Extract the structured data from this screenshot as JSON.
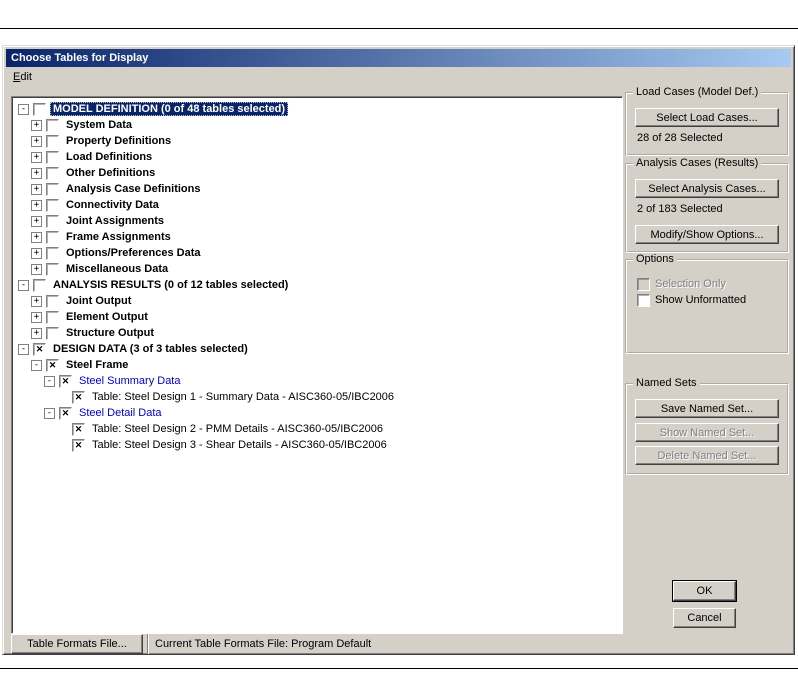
{
  "window": {
    "title": "Choose Tables for Display"
  },
  "menu": {
    "edit": "Edit"
  },
  "tree": {
    "items": [
      {
        "label": "MODEL DEFINITION  (0 of 48 tables selected)",
        "level": 0,
        "exp": "minus",
        "checked": false,
        "bold": true,
        "blue": false,
        "selected": true
      },
      {
        "label": "System Data",
        "level": 1,
        "exp": "plus",
        "checked": false,
        "bold": true,
        "blue": false,
        "selected": false
      },
      {
        "label": "Property Definitions",
        "level": 1,
        "exp": "plus",
        "checked": false,
        "bold": true,
        "blue": false,
        "selected": false
      },
      {
        "label": "Load Definitions",
        "level": 1,
        "exp": "plus",
        "checked": false,
        "bold": true,
        "blue": false,
        "selected": false
      },
      {
        "label": "Other Definitions",
        "level": 1,
        "exp": "plus",
        "checked": false,
        "bold": true,
        "blue": false,
        "selected": false
      },
      {
        "label": "Analysis Case Definitions",
        "level": 1,
        "exp": "plus",
        "checked": false,
        "bold": true,
        "blue": false,
        "selected": false
      },
      {
        "label": "Connectivity Data",
        "level": 1,
        "exp": "plus",
        "checked": false,
        "bold": true,
        "blue": false,
        "selected": false
      },
      {
        "label": "Joint Assignments",
        "level": 1,
        "exp": "plus",
        "checked": false,
        "bold": true,
        "blue": false,
        "selected": false
      },
      {
        "label": "Frame Assignments",
        "level": 1,
        "exp": "plus",
        "checked": false,
        "bold": true,
        "blue": false,
        "selected": false
      },
      {
        "label": "Options/Preferences Data",
        "level": 1,
        "exp": "plus",
        "checked": false,
        "bold": true,
        "blue": false,
        "selected": false
      },
      {
        "label": "Miscellaneous Data",
        "level": 1,
        "exp": "plus",
        "checked": false,
        "bold": true,
        "blue": false,
        "selected": false
      },
      {
        "label": "ANALYSIS RESULTS  (0 of 12 tables selected)",
        "level": 0,
        "exp": "minus",
        "checked": false,
        "bold": true,
        "blue": false,
        "selected": false
      },
      {
        "label": "Joint Output",
        "level": 1,
        "exp": "plus",
        "checked": false,
        "bold": true,
        "blue": false,
        "selected": false
      },
      {
        "label": "Element Output",
        "level": 1,
        "exp": "plus",
        "checked": false,
        "bold": true,
        "blue": false,
        "selected": false
      },
      {
        "label": "Structure Output",
        "level": 1,
        "exp": "plus",
        "checked": false,
        "bold": true,
        "blue": false,
        "selected": false
      },
      {
        "label": "DESIGN DATA  (3 of 3 tables selected)",
        "level": 0,
        "exp": "minus",
        "checked": true,
        "bold": true,
        "blue": false,
        "selected": false
      },
      {
        "label": "Steel Frame",
        "level": 1,
        "exp": "minus",
        "checked": true,
        "bold": true,
        "blue": false,
        "selected": false
      },
      {
        "label": "Steel Summary Data",
        "level": 2,
        "exp": "minus",
        "checked": true,
        "bold": false,
        "blue": true,
        "selected": false
      },
      {
        "label": "Table:  Steel Design 1 - Summary Data - AISC360-05/IBC2006",
        "level": 3,
        "exp": "none",
        "checked": true,
        "bold": false,
        "blue": false,
        "selected": false
      },
      {
        "label": "Steel Detail Data",
        "level": 2,
        "exp": "minus",
        "checked": true,
        "bold": false,
        "blue": true,
        "selected": false
      },
      {
        "label": "Table:  Steel Design 2 - PMM Details - AISC360-05/IBC2006",
        "level": 3,
        "exp": "none",
        "checked": true,
        "bold": false,
        "blue": false,
        "selected": false
      },
      {
        "label": "Table:  Steel Design 3 - Shear Details - AISC360-05/IBC2006",
        "level": 3,
        "exp": "none",
        "checked": true,
        "bold": false,
        "blue": false,
        "selected": false
      }
    ]
  },
  "panels": {
    "load_cases": {
      "title": "Load Cases (Model Def.)",
      "select_button": "Select Load Cases...",
      "status": "28 of 28 Selected"
    },
    "analysis_cases": {
      "title": "Analysis Cases (Results)",
      "select_button": "Select Analysis Cases...",
      "status": "2 of 183 Selected",
      "modify_button": "Modify/Show Options..."
    },
    "options": {
      "title": "Options",
      "selection_only": "Selection Only",
      "show_unformatted": "Show Unformatted"
    },
    "named_sets": {
      "title": "Named Sets",
      "save_button": "Save Named Set...",
      "show_button": "Show Named Set...",
      "delete_button": "Delete Named Set..."
    }
  },
  "buttons": {
    "ok": "OK",
    "cancel": "Cancel"
  },
  "footer": {
    "formats_button": "Table Formats File...",
    "current_file_label": "Current Table Formats File:  Program Default"
  },
  "colors": {
    "titlebar_start": "#0a246a",
    "titlebar_end": "#a6caf0",
    "dialog_bg": "#d4d0c8",
    "selection_bg": "#0a246a",
    "tree_link_blue": "#0000c8"
  }
}
